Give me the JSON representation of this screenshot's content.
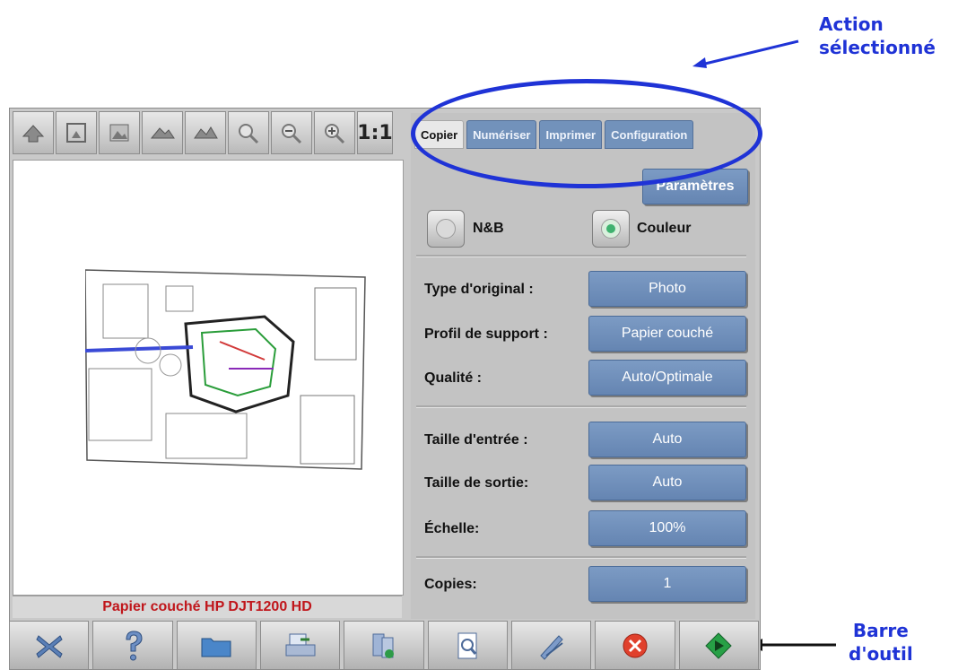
{
  "annotations": {
    "action_line1": "Action",
    "action_line2": "sélectionné",
    "barre_line1": "Barre",
    "barre_line2": "d'outil"
  },
  "toolbar_top": {
    "icons": [
      "rotate-left-icon",
      "fit-page-icon",
      "image-icon",
      "landscape-icon",
      "landscape-2-icon",
      "zoom-tool-icon",
      "zoom-out-icon",
      "zoom-in-icon"
    ],
    "one_to_one": "1:1"
  },
  "preview": {
    "caption": "Papier couché HP DJT1200 HD"
  },
  "tabs": [
    {
      "label": "Copier",
      "active": true
    },
    {
      "label": "Numériser",
      "active": false
    },
    {
      "label": "Imprimer",
      "active": false
    },
    {
      "label": "Configuration",
      "active": false
    }
  ],
  "settings_button": "Paramètres",
  "color_mode": {
    "bw_label": "N&B",
    "color_label": "Couleur",
    "selected": "Couleur"
  },
  "rows": [
    {
      "label": "Type d'original :",
      "value": "Photo"
    },
    {
      "label": "Profil de support :",
      "value": "Papier couché"
    },
    {
      "label": "Qualité :",
      "value": "Auto/Optimale"
    },
    {
      "label": "Taille d'entrée :",
      "value": "Auto"
    },
    {
      "label": "Taille de sortie:",
      "value": "Auto"
    },
    {
      "label": "Échelle:",
      "value": "100%"
    },
    {
      "label": "Copies:",
      "value": "1"
    }
  ],
  "bottom_toolbar": {
    "icons": [
      "close-x-icon",
      "help-icon",
      "folder-icon",
      "scan-to-file-icon",
      "print-queue-icon",
      "preview-icon",
      "tools-icon",
      "cancel-icon",
      "start-icon"
    ]
  },
  "colors": {
    "annotation_blue": "#1f33d6",
    "tab_blue": "#7292bb",
    "caption_red": "#c0161b"
  }
}
